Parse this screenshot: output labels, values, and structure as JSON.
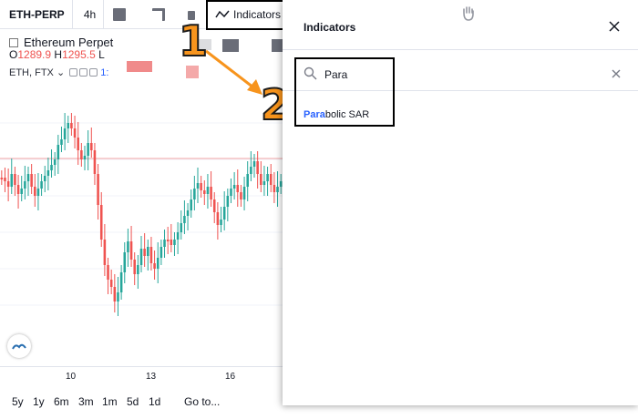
{
  "toolbar": {
    "symbol": "ETH-PERP",
    "timeframe": "4h",
    "indicators_label": "Indicators"
  },
  "legend": {
    "name": "Ethereum Perpet",
    "open_label": "O",
    "open_value": "1289.9",
    "high_label": "H",
    "high_value": "1295.5",
    "low_label": "L",
    "exchange": "ETH, FTX",
    "extra": "1:"
  },
  "colors": {
    "up": "#26a69a",
    "down": "#ef5350",
    "accent": "#2962ff",
    "annotation": "#f7941d"
  },
  "x_axis": [
    "10",
    "13",
    "16"
  ],
  "range_buttons": [
    "5y",
    "1y",
    "6m",
    "3m",
    "1m",
    "5d",
    "1d"
  ],
  "goto_label": "Go to...",
  "annotations": {
    "step1": "1",
    "step2": "2"
  },
  "dialog": {
    "title": "Indicators",
    "search_value": "Para",
    "result_match": "Para",
    "result_rest": "bolic SAR"
  },
  "icons": {
    "close": "close-icon",
    "search": "search-icon",
    "clear": "clear-icon",
    "indicators": "indicators-icon"
  }
}
